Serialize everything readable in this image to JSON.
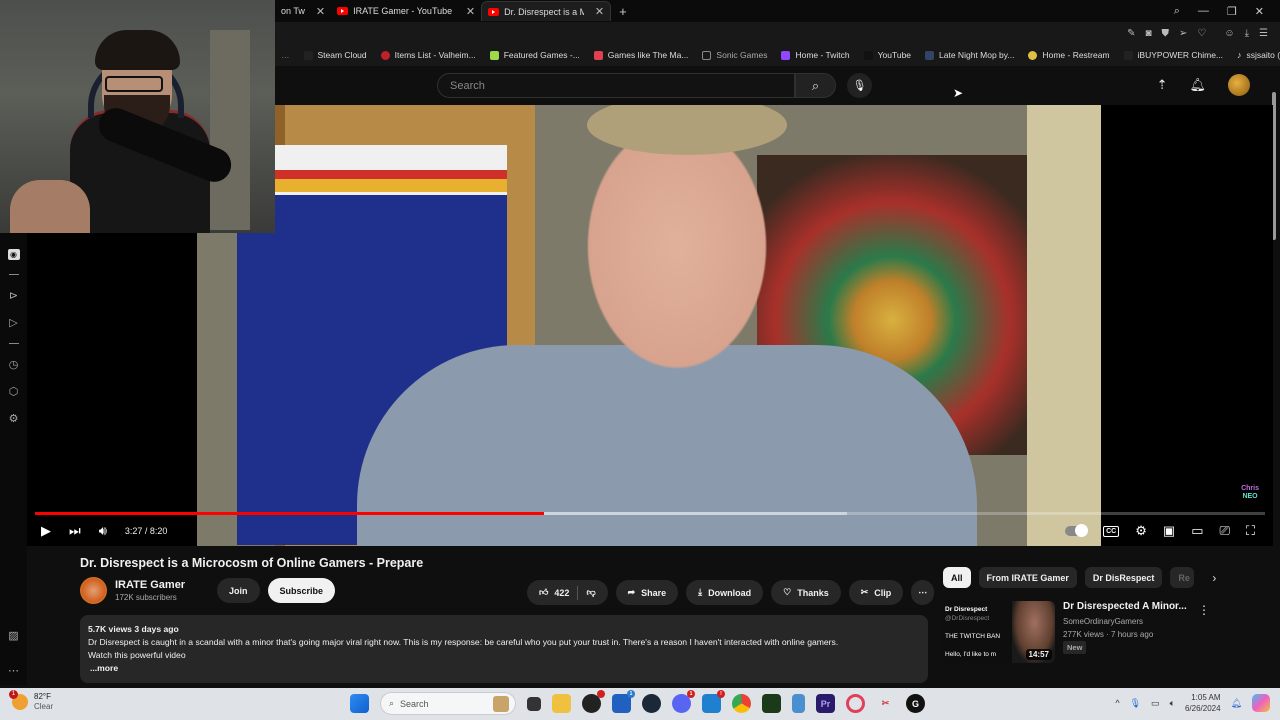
{
  "browser": {
    "tabs": [
      {
        "title": "on Tw",
        "active": false
      },
      {
        "title": "IRATE Gamer - YouTube",
        "active": false
      },
      {
        "title": "Dr. Disrespect is a Microcosm",
        "active": true
      }
    ],
    "new_tab_label": "+",
    "bookmarks": [
      {
        "label": "Steam Cloud",
        "color": "#222222"
      },
      {
        "label": "Items List - Valheim...",
        "color": "#c0202a"
      },
      {
        "label": "Featured Games -...",
        "color": "#9fd84a"
      },
      {
        "label": "Games like The Ma...",
        "color": "#e04050"
      },
      {
        "label": "Sonic Games",
        "color": "#888888"
      },
      {
        "label": "Home - Twitch",
        "color": "#9146ff"
      },
      {
        "label": "YouTube",
        "color": "#111111"
      },
      {
        "label": "Late Night Mop by...",
        "color": "#334466"
      },
      {
        "label": "Home - Restream",
        "color": "#e0c040"
      },
      {
        "label": "iBUYPOWER Chime...",
        "color": "#222222"
      },
      {
        "label": "ssjsaito (@ssjsaito)...",
        "color": "#ffffff"
      }
    ],
    "bookmarks_overflow": "»"
  },
  "youtube": {
    "search_placeholder": "Search",
    "video": {
      "title": "Dr. Disrespect is a Microcosm of Online Gamers - Prepare",
      "current_time": "3:27",
      "duration": "8:20",
      "time_display": "3:27 / 8:20",
      "progress_fraction": 0.414,
      "buffered_fraction": 0.66,
      "watermark_line1": "Chris",
      "watermark_line2": "NEO"
    },
    "channel": {
      "name": "IRATE Gamer",
      "subscribers": "172K subscribers",
      "join_label": "Join",
      "subscribe_label": "Subscribe"
    },
    "actions": {
      "likes": "422",
      "share": "Share",
      "download": "Download",
      "thanks": "Thanks",
      "clip": "Clip",
      "more": "⋯"
    },
    "description": {
      "meta": "5.7K views  3 days ago",
      "line1": "Dr Disrespect is caught in a scandal with a minor that's going major viral right now. This is my response: be careful who you put your trust in. There's a reason I haven't interacted with online gamers.",
      "line2": "Watch this powerful video",
      "more": "...more"
    },
    "chips": [
      "All",
      "From IRATE Gamer",
      "Dr DisRespect",
      "Re"
    ],
    "recommendation": {
      "title": "Dr Disrespected A Minor...",
      "channel": "SomeOrdinaryGamers",
      "stats": "277K views  · 7 hours ago",
      "badge": "New",
      "duration": "14:57",
      "thumb_name": "Dr Disrespect",
      "thumb_handle": "@DrDisrespect",
      "thumb_headline": "THE TWITCH BAN",
      "thumb_text": "Hello, I'd like to m"
    }
  },
  "taskbar": {
    "weather_temp": "82°F",
    "weather_cond": "Clear",
    "weather_badge": "1",
    "search_label": "Search",
    "time": "1:05 AM",
    "date": "6/26/2024",
    "badges": {
      "store": "1",
      "discord": "1",
      "alert": "!"
    }
  }
}
